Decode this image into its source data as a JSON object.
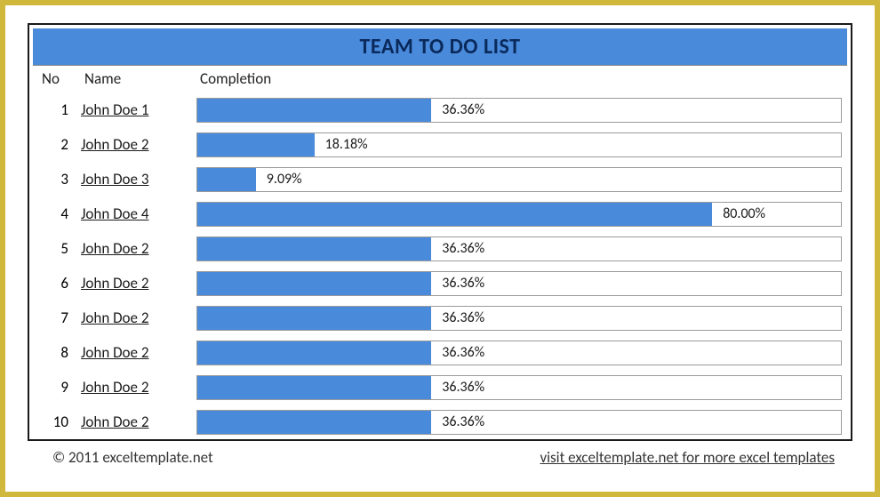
{
  "title": "TEAM TO DO LIST",
  "headers": {
    "no": "No",
    "name": "Name",
    "completion": "Completion"
  },
  "rows": [
    {
      "no": "1",
      "name": "John Doe 1",
      "pct": 36.36,
      "label": "36.36%"
    },
    {
      "no": "2",
      "name": "John Doe 2",
      "pct": 18.18,
      "label": "18.18%"
    },
    {
      "no": "3",
      "name": "John Doe 3",
      "pct": 9.09,
      "label": "9.09%"
    },
    {
      "no": "4",
      "name": "John Doe 4",
      "pct": 80.0,
      "label": "80.00%"
    },
    {
      "no": "5",
      "name": "John Doe 2",
      "pct": 36.36,
      "label": "36.36%"
    },
    {
      "no": "6",
      "name": "John Doe 2",
      "pct": 36.36,
      "label": "36.36%"
    },
    {
      "no": "7",
      "name": "John Doe 2",
      "pct": 36.36,
      "label": "36.36%"
    },
    {
      "no": "8",
      "name": "John Doe 2",
      "pct": 36.36,
      "label": "36.36%"
    },
    {
      "no": "9",
      "name": "John Doe 2",
      "pct": 36.36,
      "label": "36.36%"
    },
    {
      "no": "10",
      "name": "John Doe 2",
      "pct": 36.36,
      "label": "36.36%"
    }
  ],
  "footer": {
    "copyright": "© 2011 exceltemplate.net",
    "link": "visit exceltemplate.net for more excel templates"
  },
  "chart_data": {
    "type": "bar",
    "orientation": "horizontal",
    "categories": [
      "John Doe 1",
      "John Doe 2",
      "John Doe 3",
      "John Doe 4",
      "John Doe 2",
      "John Doe 2",
      "John Doe 2",
      "John Doe 2",
      "John Doe 2",
      "John Doe 2"
    ],
    "values": [
      36.36,
      18.18,
      9.09,
      80.0,
      36.36,
      36.36,
      36.36,
      36.36,
      36.36,
      36.36
    ],
    "title": "TEAM TO DO LIST",
    "xlabel": "Completion",
    "ylabel": "Name",
    "xlim": [
      0,
      100
    ]
  }
}
